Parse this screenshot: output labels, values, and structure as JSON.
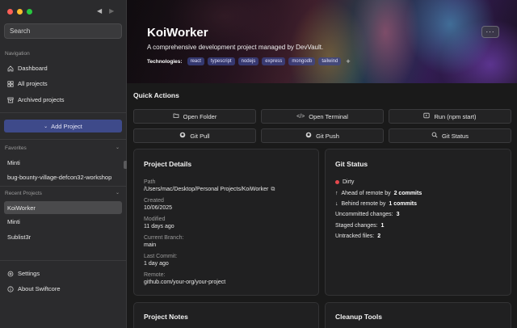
{
  "window": {
    "back_arrow": "◀",
    "forward_arrow": "▶"
  },
  "sidebar": {
    "search_placeholder": "Search",
    "navigation_label": "Navigation",
    "nav_items": [
      {
        "label": "Dashboard",
        "icon": "home-icon"
      },
      {
        "label": "All projects",
        "icon": "grid-icon"
      },
      {
        "label": "Archived projects",
        "icon": "archive-icon"
      }
    ],
    "add_project_label": "Add Project",
    "favorites_label": "Favorites",
    "favorites": [
      "Minti",
      "bug-bounty-village-defcon32-workshop"
    ],
    "recent_label": "Recent Projects",
    "recent": [
      "KoiWorker",
      "Minti",
      "Sublist3r"
    ],
    "selected_recent": "KoiWorker",
    "settings_label": "Settings",
    "about_label": "About Swiftcore"
  },
  "hero": {
    "title": "KoiWorker",
    "subtitle": "A comprehensive development project managed by DevVault.",
    "technologies_label": "Technologies:",
    "technologies": [
      "react",
      "typescript",
      "nodejs",
      "express",
      "mongodb",
      "tailwind"
    ],
    "add_tech": "+",
    "more_label": "···"
  },
  "quick_actions": {
    "title": "Quick Actions",
    "buttons": [
      {
        "label": "Open Folder",
        "icon": "folder-icon"
      },
      {
        "label": "Open Terminal",
        "icon": "terminal-icon"
      },
      {
        "label": "Run (npm start)",
        "icon": "run-icon"
      },
      {
        "label": "Git Pull",
        "icon": "github-icon"
      },
      {
        "label": "Git Push",
        "icon": "github-icon"
      },
      {
        "label": "Git Status",
        "icon": "search-icon"
      }
    ]
  },
  "project_details": {
    "title": "Project Details",
    "path_label": "Path",
    "path": "/Users/mac/Desktop/Personal Projects/KoiWorker",
    "created_label": "Created",
    "created": "10/06/2025",
    "modified_label": "Modified",
    "modified": "11 days ago",
    "branch_label": "Current Branch:",
    "branch": "main",
    "last_commit_label": "Last Commit:",
    "last_commit": "1 day ago",
    "remote_label": "Remote:",
    "remote": "github.com/your-org/your-project"
  },
  "git_status": {
    "title": "Git Status",
    "state": "Dirty",
    "ahead_prefix": "Ahead of remote by",
    "ahead": "2 commits",
    "behind_prefix": "Behind remote by",
    "behind": "1 commits",
    "uncommitted_label": "Uncommitted changes:",
    "uncommitted": "3",
    "staged_label": "Staged changes:",
    "staged": "1",
    "untracked_label": "Untracked files:",
    "untracked": "2",
    "dirty_color": "#e5484d"
  },
  "project_notes": {
    "title": "Project Notes"
  },
  "cleanup_tools": {
    "title": "Cleanup Tools"
  }
}
